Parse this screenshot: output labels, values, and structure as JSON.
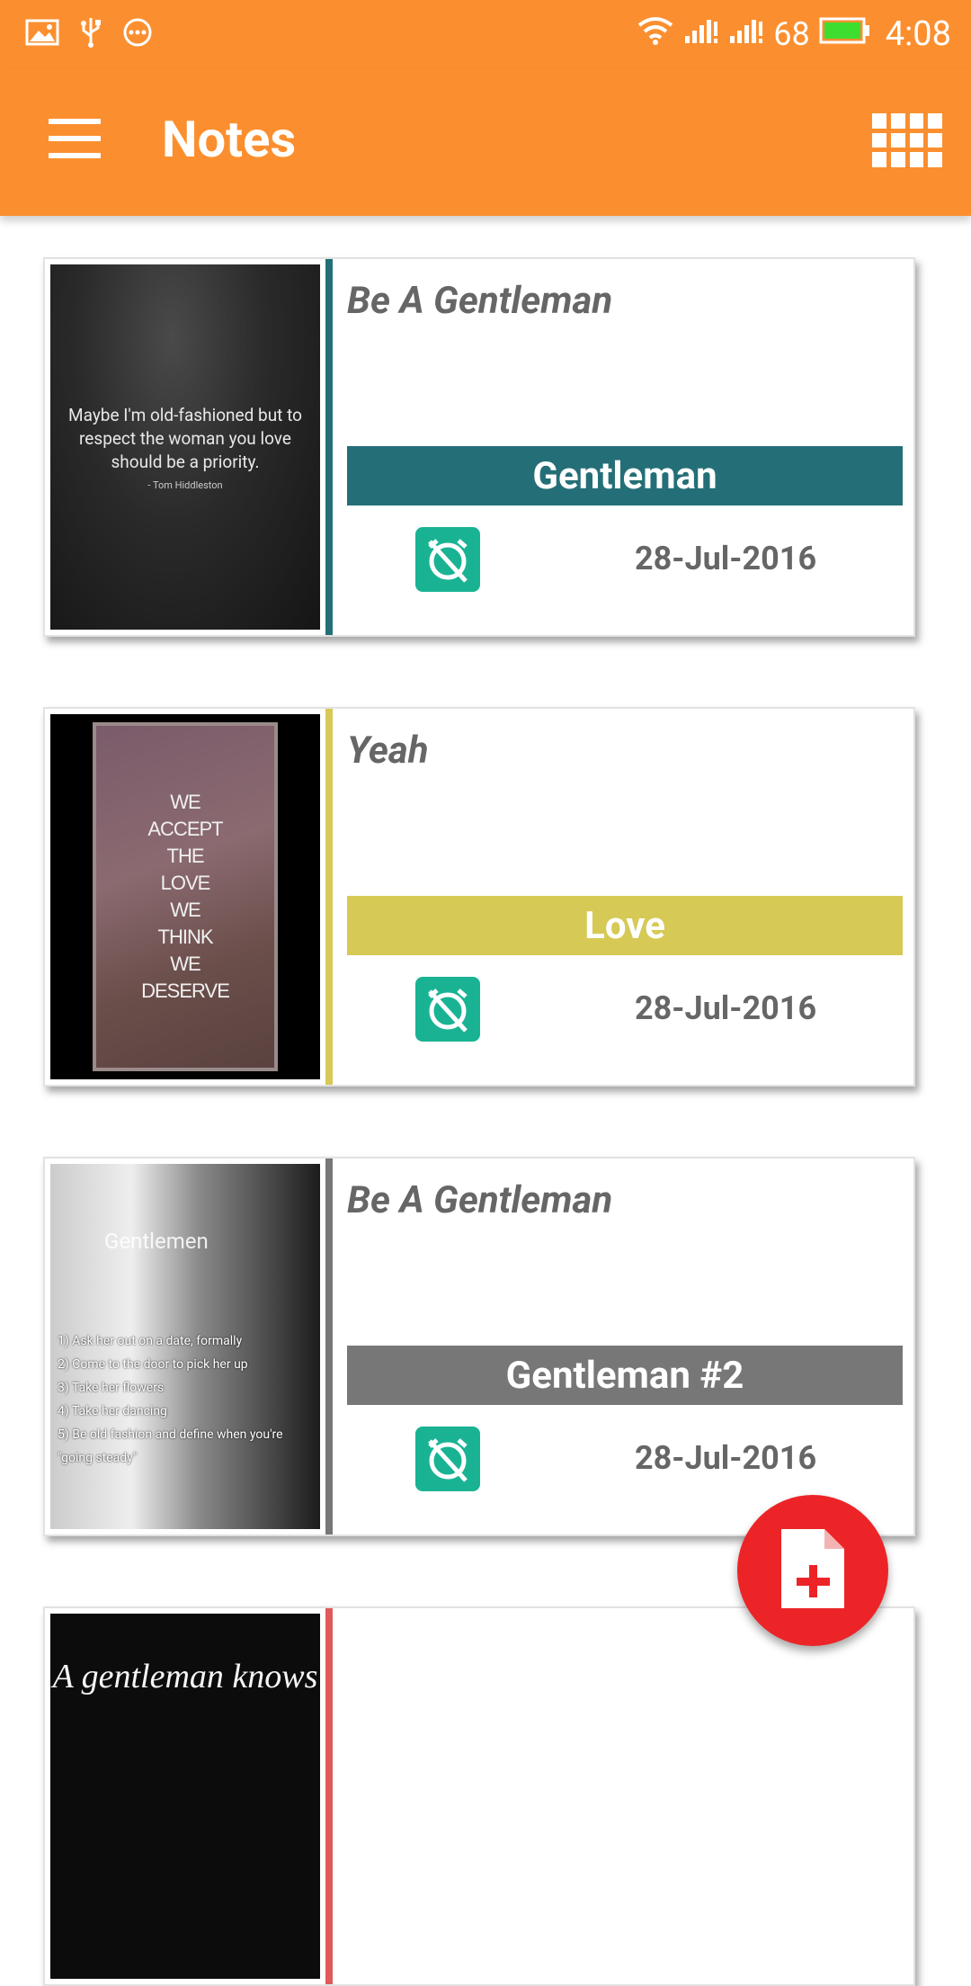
{
  "status_bar": {
    "battery_percent": "68",
    "time": "4:08",
    "icons": [
      "image-icon",
      "usb-icon",
      "more-icon",
      "wifi-icon",
      "signal-icon",
      "signal-icon-2",
      "battery-icon"
    ]
  },
  "app_bar": {
    "title": "Notes",
    "menu_icon": "hamburger-menu-icon",
    "view_toggle_icon": "grid-view-icon"
  },
  "notes": [
    {
      "title": "Be A Gentleman",
      "category": "Gentleman",
      "category_color": "#246f77",
      "date": "28-Jul-2016",
      "thumb_quote": "Maybe I'm old-fashioned but to respect the woman you love should be a priority.",
      "thumb_attr": "- Tom Hiddleston"
    },
    {
      "title": "Yeah",
      "category": "Love",
      "category_color": "#d6c955",
      "date": "28-Jul-2016",
      "thumb_lines": [
        "WE",
        "ACCEPT",
        "THE",
        "LOVE",
        "WE",
        "THINK",
        "WE",
        "DESERVE"
      ]
    },
    {
      "title": "Be A Gentleman",
      "category": "Gentleman #2",
      "category_color": "#777777",
      "date": "28-Jul-2016",
      "thumb_title": "Gentlemen",
      "thumb_lines": [
        "1) Ask her out on a date, formally",
        "2) Come to the door to pick her up",
        "3) Take her flowers",
        "4) Take her dancing",
        "5) Be old fashion and define when you're \"going steady\""
      ]
    },
    {
      "title": "",
      "category": "",
      "category_color": "#e05a5a",
      "date": "",
      "thumb_text": "A gentleman knows"
    }
  ],
  "fab": {
    "icon": "add-note-icon",
    "color": "#ec2427"
  },
  "colors": {
    "accent": "#fb8f2f",
    "alarm": "#19b394"
  }
}
